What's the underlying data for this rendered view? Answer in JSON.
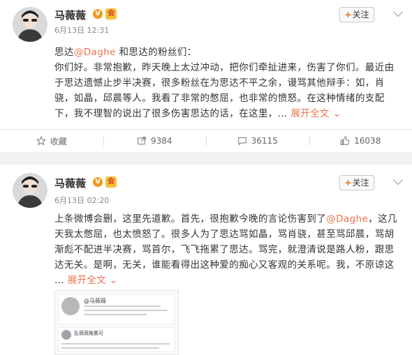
{
  "posts": [
    {
      "author": "马薇薇",
      "verified_badge": "V",
      "member_badge": "会",
      "time": "6月13日 12:31",
      "follow_label": "关注",
      "text_lines": [
        "思达@Daghe 和思达的粉丝们：",
        "你们好。非常抱歉，昨天晚上太过冲动，把你们牵扯进来，伤害了你们。最近由",
        "于思达遗憾止步半决赛，很多粉丝在为思达不平之余，谩骂其他辩手：如，肖",
        "骁，如晶，邱晨等人。我看了非常的憋屈，也非常的愤怒。在这种情绪的支配",
        "下，我不理智的说出了很多伤害思达的话，在这里，… 展开全文"
      ],
      "greeting_prefix": "思达",
      "mention": "@Daghe",
      "greeting_suffix": " 和思达的粉丝们：",
      "line2": "你们好。非常抱歉，昨天晚上太过冲动，把你们牵扯进来，伤害了你们。最近由",
      "line3": "于思达遗憾止步半决赛，很多粉丝在为思达不平之余，谩骂其他辩手：如，肖",
      "line4": "骁，如晶，邱晨等人。我看了非常的憋屈，也非常的愤怒。在这种情绪的支配",
      "line5": "下，我不理智的说出了很多伤害思达的话，在这里，…",
      "expand_label": "展开全文",
      "actions": {
        "favorite": "收藏",
        "share_count": "9384",
        "comment_count": "36115",
        "like_count": "16038"
      }
    },
    {
      "author": "马薇薇",
      "verified_badge": "V",
      "member_badge": "会",
      "time": "6月13日 02:20",
      "follow_label": "关注",
      "line1_prefix": "上条微博会删，这里先道歉。首先，很抱歉今晚的言论伤害到了",
      "mention": "@Daghe",
      "line1_suffix": "，这几",
      "line2": "天我太憋屈，也太愤怒了。很多人为了思达骂如晶，骂肖骁，甚至骂邱晨，骂胡",
      "line3": "渐彪不配进半决赛，骂首尔，飞飞拖累了思达。骂完，就澄清说是路人粉，跟思",
      "line4": "达无关。是啊，无关，谁能看得出这种爱的痴心又客观的关系呢。我，不原谅这",
      "line5_prefix": "…",
      "expand_label": "展开全文",
      "embed": {
        "name1": "@马薇薇",
        "name2": "乱薇薇推薦可"
      }
    }
  ],
  "colors": {
    "accent": "#eb7350",
    "follow_plus": "#f06a12",
    "badge_orange": "#f29a20",
    "background": "#f2f2f5"
  }
}
